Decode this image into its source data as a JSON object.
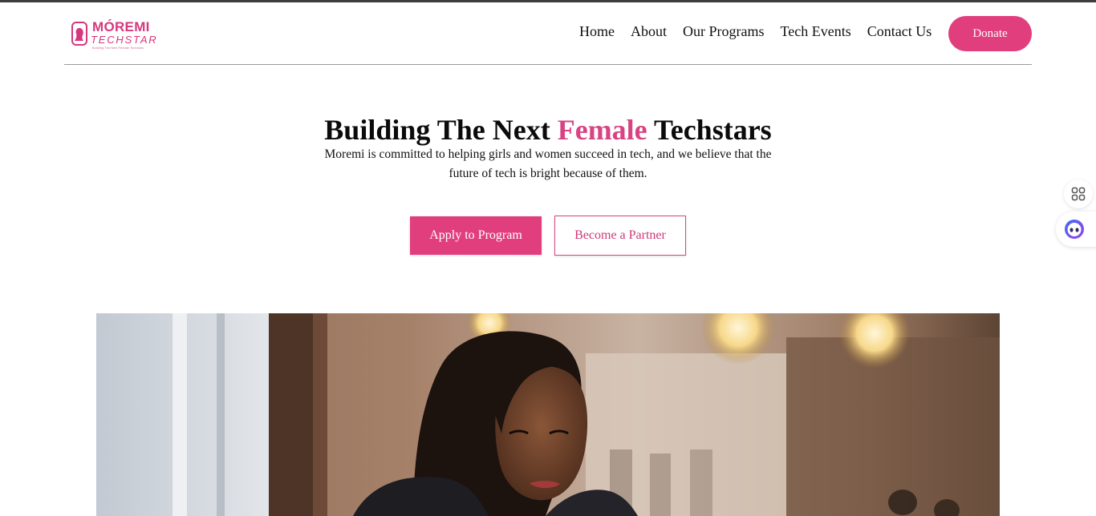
{
  "brand": {
    "name_line1": "MÓREMI",
    "name_line2": "TECHSTAR",
    "tagline": "Building The Next Female Techstars",
    "color": "#d6377e"
  },
  "nav": {
    "items": [
      {
        "label": "Home"
      },
      {
        "label": "About"
      },
      {
        "label": "Our Programs"
      },
      {
        "label": "Tech Events"
      },
      {
        "label": "Contact Us"
      }
    ],
    "donate_label": "Donate"
  },
  "hero": {
    "title_before": "Building The Next ",
    "title_accent": "Female",
    "title_after": " Techstars",
    "subtitle": "Moremi is committed to helping girls and women succeed in tech, and we believe that the future of tech is bright because of them.",
    "primary_cta": "Apply to Program",
    "secondary_cta": "Become a Partner",
    "accent_color": "#e13e7e"
  },
  "widgets": {
    "apps_icon": "apps-grid-icon",
    "assistant_icon": "assistant-bot-icon"
  },
  "photo": {
    "subject": "hero-photo-woman-in-cafe"
  }
}
